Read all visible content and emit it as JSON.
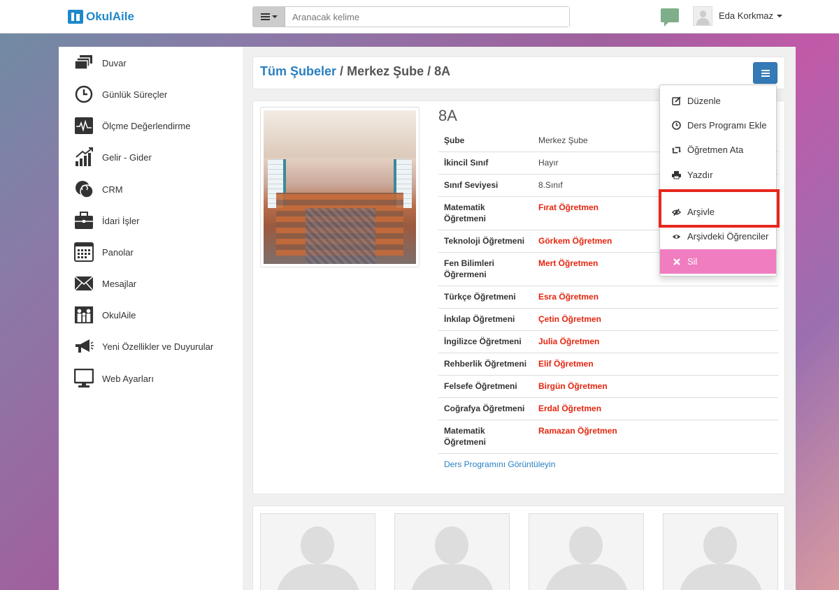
{
  "app": {
    "logo_text": "OkulAile",
    "brand_color": "#1e88c9"
  },
  "search": {
    "placeholder": "Aranacak kelime"
  },
  "user": {
    "name": "Eda Korkmaz"
  },
  "sidebar": {
    "items": [
      {
        "label": "Duvar",
        "icon": "wall-icon"
      },
      {
        "label": "Günlük Süreçler",
        "icon": "clock-icon"
      },
      {
        "label": "Ölçme Değerlendirme",
        "icon": "measurement-icon"
      },
      {
        "label": "Gelir - Gider",
        "icon": "chart-icon"
      },
      {
        "label": "CRM",
        "icon": "crm-icon"
      },
      {
        "label": "İdari İşler",
        "icon": "briefcase-icon"
      },
      {
        "label": "Panolar",
        "icon": "calendar-icon"
      },
      {
        "label": "Mesajlar",
        "icon": "envelope-icon"
      },
      {
        "label": "OkulAile",
        "icon": "family-icon"
      },
      {
        "label": "Yeni Özellikler ve Duyurular",
        "icon": "megaphone-icon"
      },
      {
        "label": "Web Ayarları",
        "icon": "monitor-icon"
      }
    ]
  },
  "breadcrumb": {
    "root": "Tüm Şubeler",
    "separator": "/",
    "branch": "Merkez Şube",
    "class": "8A"
  },
  "class_info": {
    "title": "8A",
    "rows": [
      {
        "label": "Şube",
        "value": "Merkez Şube",
        "teacher": false
      },
      {
        "label": "İkincil Sınıf",
        "value": "Hayır",
        "teacher": false
      },
      {
        "label": "Sınıf Seviyesi",
        "value": "8.Sınıf",
        "teacher": false
      },
      {
        "label": "Matematik Öğretmeni",
        "value": "Fırat Öğretmen",
        "teacher": true
      },
      {
        "label": "Teknoloji Öğretmeni",
        "value": "Görkem Öğretmen",
        "teacher": true
      },
      {
        "label": "Fen Bilimleri Öğrermeni",
        "value": "Mert Öğretmen",
        "teacher": true
      },
      {
        "label": "Türkçe Öğretmeni",
        "value": "Esra Öğretmen",
        "teacher": true
      },
      {
        "label": "İnkılap Öğretmeni",
        "value": "Çetin Öğretmen",
        "teacher": true
      },
      {
        "label": "İngilizce Öğretmeni",
        "value": "Julia Öğretmen",
        "teacher": true
      },
      {
        "label": "Rehberlik Öğretmeni",
        "value": "Elif Öğretmen",
        "teacher": true
      },
      {
        "label": "Felsefe Öğretmeni",
        "value": "Birgün Öğretmen",
        "teacher": true
      },
      {
        "label": "Coğrafya Öğretmeni",
        "value": "Erdal Öğretmen",
        "teacher": true
      },
      {
        "label": "Matematik Öğretmeni",
        "value": "Ramazan Öğretmen",
        "teacher": true
      }
    ],
    "schedule_link": "Ders Programını Görüntüleyin"
  },
  "dropdown": {
    "items": [
      {
        "label": "Düzenle",
        "icon": "edit-icon"
      },
      {
        "label": "Ders Programı Ekle",
        "icon": "clock-icon"
      },
      {
        "label": "Öğretmen Ata",
        "icon": "retweet-icon"
      },
      {
        "label": "Yazdır",
        "icon": "print-icon"
      },
      {
        "label": "Arşivle",
        "icon": "eye-slash-icon"
      },
      {
        "label": "Arşivdeki Öğrenciler",
        "icon": "eye-icon"
      },
      {
        "label": "Sil",
        "icon": "close-icon"
      }
    ],
    "danger_color": "#f07dc0",
    "highlight_color": "#e8261c"
  },
  "colors": {
    "link": "#2a7fc1",
    "teacher": "#e5250f",
    "primary_button": "#337ab7"
  }
}
